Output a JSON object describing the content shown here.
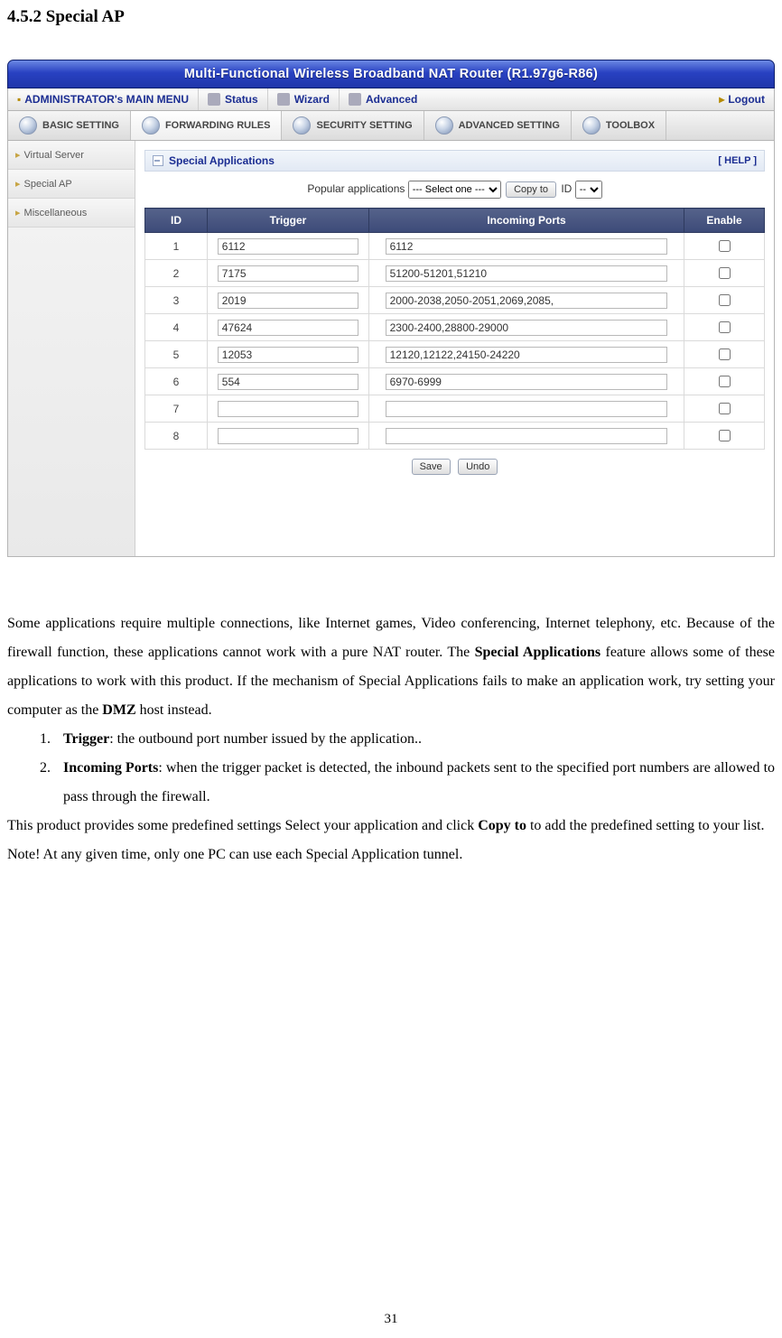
{
  "heading": "4.5.2 Special AP",
  "titlebar": "Multi-Functional Wireless Broadband NAT Router (R1.97g6-R86)",
  "menubar": {
    "admin_label": "ADMINISTRATOR's MAIN MENU",
    "status_label": "Status",
    "wizard_label": "Wizard",
    "advanced_label": "Advanced",
    "logout_label": "Logout"
  },
  "tabs": {
    "basic": "BASIC SETTING",
    "forwarding": "FORWARDING RULES",
    "security": "SECURITY SETTING",
    "advanced": "ADVANCED SETTING",
    "toolbox": "TOOLBOX"
  },
  "sidebar": {
    "virtual_server": "Virtual Server",
    "special_ap": "Special AP",
    "misc": "Miscellaneous"
  },
  "panel": {
    "title": "Special Applications",
    "help": "[ HELP ]",
    "popular_label": "Popular applications",
    "select_placeholder": "--- Select one ---",
    "copyto_label": "Copy to",
    "id_label": "ID",
    "id_select": "--"
  },
  "table": {
    "headers": {
      "id": "ID",
      "trigger": "Trigger",
      "incoming": "Incoming Ports",
      "enable": "Enable"
    },
    "rows": [
      {
        "id": "1",
        "trigger": "6112",
        "incoming": "6112"
      },
      {
        "id": "2",
        "trigger": "7175",
        "incoming": "51200-51201,51210"
      },
      {
        "id": "3",
        "trigger": "2019",
        "incoming": "2000-2038,2050-2051,2069,2085,"
      },
      {
        "id": "4",
        "trigger": "47624",
        "incoming": "2300-2400,28800-29000"
      },
      {
        "id": "5",
        "trigger": "12053",
        "incoming": "12120,12122,24150-24220"
      },
      {
        "id": "6",
        "trigger": "554",
        "incoming": "6970-6999"
      },
      {
        "id": "7",
        "trigger": "",
        "incoming": ""
      },
      {
        "id": "8",
        "trigger": "",
        "incoming": ""
      }
    ]
  },
  "buttons": {
    "save": "Save",
    "undo": "Undo"
  },
  "copy": {
    "p1a": "Some applications require multiple connections, like Internet games, Video conferencing, Internet telephony, etc. Because of the firewall function, these applications cannot work with a pure NAT router. The ",
    "p1b": "Special Applications",
    "p1c": " feature allows some of these applications to work with this product. If the mechanism of Special Applications fails to make an application work, try setting your computer as the ",
    "p1d": "DMZ",
    "p1e": " host instead.",
    "li1a": "Trigger",
    "li1b": ": the outbound port number issued by the application..",
    "li2a": "Incoming Ports",
    "li2b": ": when the trigger packet is detected, the inbound packets sent to the specified port numbers are allowed to pass through the firewall.",
    "p2a": "This product provides some predefined settings Select your application and click ",
    "p2b": "Copy to",
    "p2c": " to add the predefined setting to your list.",
    "p3": "Note! At any given time, only one PC can use each Special Application tunnel."
  },
  "page_number": "31"
}
